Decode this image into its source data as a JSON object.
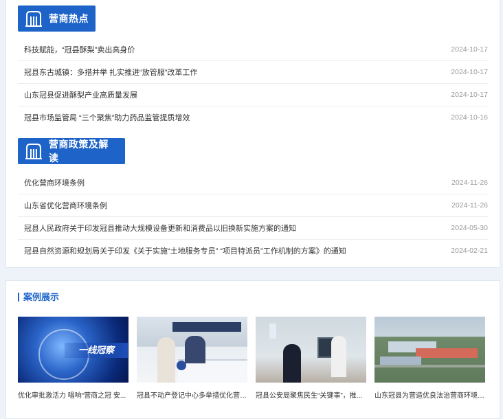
{
  "hot": {
    "title": "营商热点",
    "icon": "building-icon",
    "items": [
      {
        "title": "科技赋能，“冠县酥梨”卖出高身价",
        "date": "2024-10-17"
      },
      {
        "title": "冠县东古城镇：多措并举 扎实推进“放管服”改革工作",
        "date": "2024-10-17"
      },
      {
        "title": "山东冠县促进酥梨产业高质量发展",
        "date": "2024-10-17"
      },
      {
        "title": "冠县市场监管局 “三个聚焦”助力药品监管提质增效",
        "date": "2024-10-16"
      }
    ]
  },
  "policy": {
    "title": "营商政策及解读",
    "icon": "building-icon",
    "items": [
      {
        "title": "优化营商环境条例",
        "date": "2024-11-26"
      },
      {
        "title": "山东省优化营商环境条例",
        "date": "2024-11-26"
      },
      {
        "title": "冠县人民政府关于印发冠县推动大规模设备更新和消费品以旧换新实施方案的通知",
        "date": "2024-05-30"
      },
      {
        "title": "冠县自然资源和规划局关于印发《关于实施“土地服务专员” “项目特派员”工作机制的方案》的通知",
        "date": "2024-02-21"
      }
    ]
  },
  "cases": {
    "title": "案例展示",
    "items": [
      {
        "caption": "优化审批激活力 唱响“营商之冠 安...",
        "image_text": "一线冠察"
      },
      {
        "caption": "冠县不动产登记中心多举措优化营商..."
      },
      {
        "caption": "冠县公安局聚焦民生“关键事”，推..."
      },
      {
        "caption": "山东冠县为营造优良法治营商环境注..."
      }
    ]
  },
  "colors": {
    "accent": "#1e64c8",
    "background": "#eef3fa"
  }
}
